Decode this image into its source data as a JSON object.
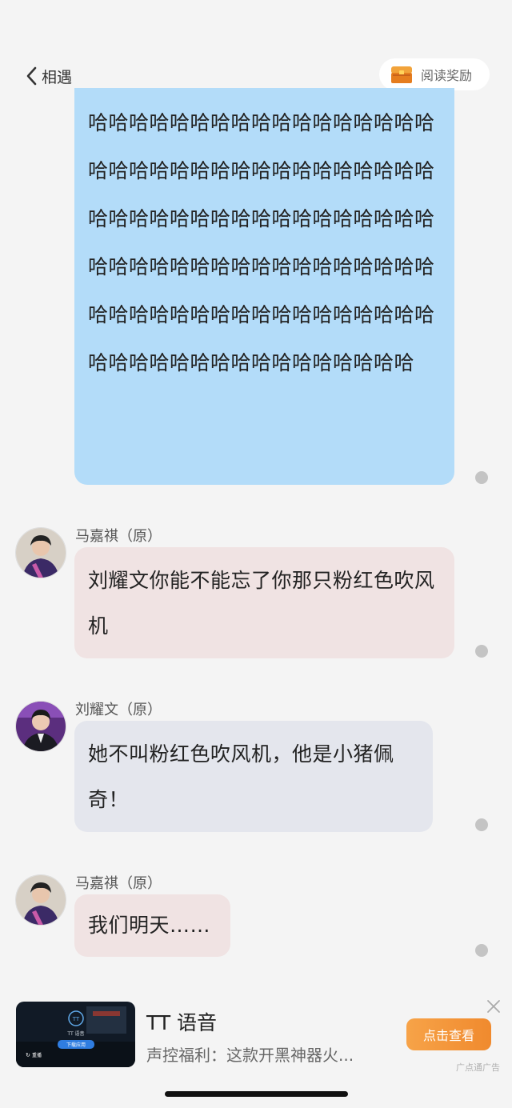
{
  "header": {
    "back_label": "相遇",
    "reward_label": "阅读奖励"
  },
  "messages": [
    {
      "text": "哈哈哈哈哈哈哈哈哈哈哈哈哈哈哈哈哈哈哈哈哈哈哈哈哈哈哈哈哈哈哈哈哈哈哈哈哈哈哈哈哈哈哈哈哈哈哈哈哈哈哈哈哈哈哈哈哈哈哈哈哈哈哈哈哈哈哈哈哈哈哈哈哈哈哈哈哈哈哈哈哈哈哈哈哈哈哈哈哈哈哈哈哈哈哈哈哈哈哈哈哈"
    },
    {
      "speaker": "马嘉祺（原）",
      "text": "刘耀文你能不能忘了你那只粉红色吹风机"
    },
    {
      "speaker": "刘耀文（原）",
      "text": "她不叫粉红色吹风机，他是小猪佩奇！"
    },
    {
      "speaker": "马嘉祺（原）",
      "text": "我们明天……"
    }
  ],
  "ad": {
    "title": "TT 语音",
    "description": "声控福利：这款开黑神器火...",
    "cta": "点击查看",
    "tag": "广点通广告",
    "thumb_logo": "TT 语音",
    "thumb_button": "下载应用",
    "thumb_replay": "重播"
  },
  "colors": {
    "bubble_blue": "#b3dcf9",
    "bubble_pink": "#f0e3e3",
    "bubble_gray": "#e4e6ed",
    "cta_orange": "#f39536"
  }
}
